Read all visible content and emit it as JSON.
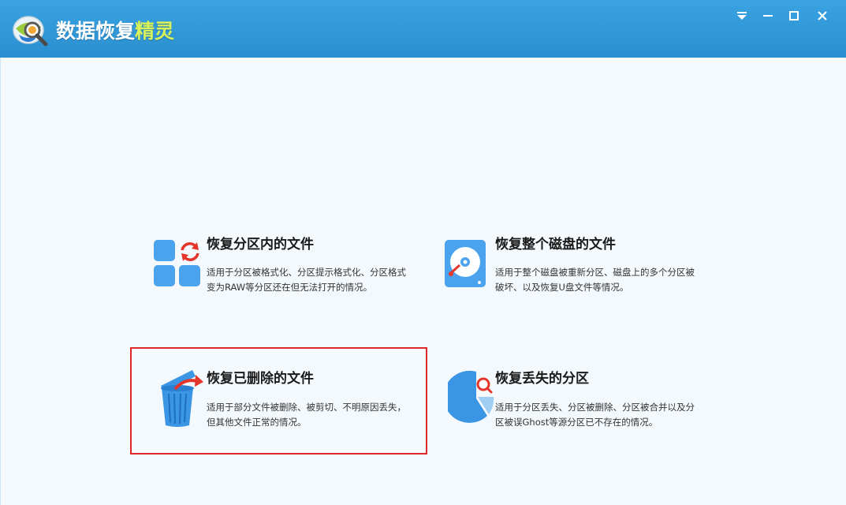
{
  "window": {
    "title_main": "数据恢复",
    "title_accent": "精灵",
    "controls": {
      "menu_icon": "menu-dropdown-icon",
      "minimize_icon": "minimize-icon",
      "maximize_icon": "maximize-icon",
      "close_icon": "close-icon"
    }
  },
  "options": [
    {
      "title": "恢复分区内的文件",
      "description": "适用于分区被格式化、分区提示格式化、分区格式变为RAW等分区还在但无法打开的情况。",
      "icon": "partition-recover-icon"
    },
    {
      "title": "恢复整个磁盘的文件",
      "description": "适用于整个磁盘被重新分区、磁盘上的多个分区被破坏、以及恢复U盘文件等情况。",
      "icon": "disk-icon"
    },
    {
      "title": "恢复已删除的文件",
      "description": "适用于部分文件被删除、被剪切、不明原因丢失，但其他文件正常的情况。",
      "icon": "recycle-bin-icon",
      "selected": true
    },
    {
      "title": "恢复丢失的分区",
      "description": "适用于分区丢失、分区被删除、分区被合并以及分区被误Ghost等源分区已不存在的情况。",
      "icon": "lost-partition-icon"
    }
  ],
  "colors": {
    "titlebar": "#2a8fd0",
    "accent_text": "#d7f25d",
    "icon_blue": "#4aa3ec",
    "icon_red": "#e5352b",
    "selection": "#e0252b"
  }
}
